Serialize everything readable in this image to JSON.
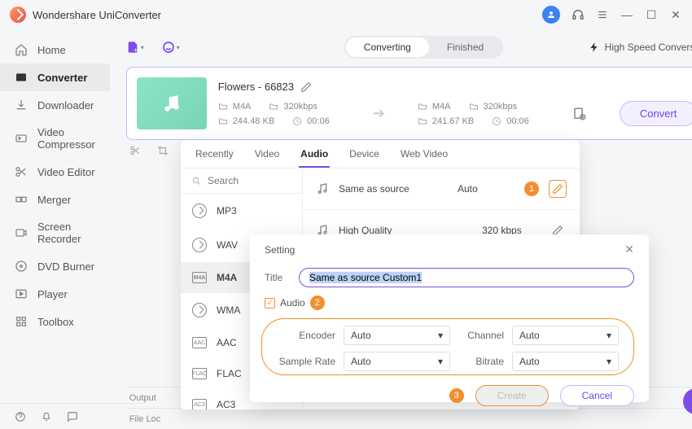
{
  "app": {
    "title": "Wondershare UniConverter"
  },
  "titlebar": {
    "min": "—",
    "max": "☐",
    "close": "✕"
  },
  "sidebar": {
    "items": [
      {
        "label": "Home"
      },
      {
        "label": "Converter"
      },
      {
        "label": "Downloader"
      },
      {
        "label": "Video Compressor"
      },
      {
        "label": "Video Editor"
      },
      {
        "label": "Merger"
      },
      {
        "label": "Screen Recorder"
      },
      {
        "label": "DVD Burner"
      },
      {
        "label": "Player"
      },
      {
        "label": "Toolbox"
      }
    ]
  },
  "toolbar": {
    "segment": {
      "converting": "Converting",
      "finished": "Finished"
    },
    "hsc": "High Speed Conversion"
  },
  "file": {
    "title": "Flowers - 66823",
    "src": {
      "fmt": "M4A",
      "br": "320kbps",
      "size": "244.48 KB",
      "dur": "00:06"
    },
    "dst": {
      "fmt": "M4A",
      "br": "320kbps",
      "size": "241.67 KB",
      "dur": "00:06"
    },
    "convert": "Convert"
  },
  "bottom": {
    "output": "Output",
    "loc": "File Loc"
  },
  "dd": {
    "tabs": {
      "recently": "Recently",
      "video": "Video",
      "audio": "Audio",
      "device": "Device",
      "web": "Web Video"
    },
    "search": "Search",
    "formats": [
      "MP3",
      "WAV",
      "M4A",
      "WMA",
      "AAC",
      "FLAC",
      "AC3"
    ],
    "presets": [
      {
        "name": "Same as source",
        "br": "Auto",
        "badge": "1"
      },
      {
        "name": "High Quality",
        "br": "320 kbps"
      }
    ]
  },
  "settings": {
    "heading": "Setting",
    "title_lbl": "Title",
    "title_val": "Same as source Custom1",
    "audio_lbl": "Audio",
    "badge2": "2",
    "fields": {
      "encoder_lbl": "Encoder",
      "encoder": "Auto",
      "channel_lbl": "Channel",
      "channel": "Auto",
      "sr_lbl": "Sample Rate",
      "sr": "Auto",
      "br_lbl": "Bitrate",
      "br": "Auto"
    },
    "badge3": "3",
    "create": "Create",
    "cancel": "Cancel"
  }
}
